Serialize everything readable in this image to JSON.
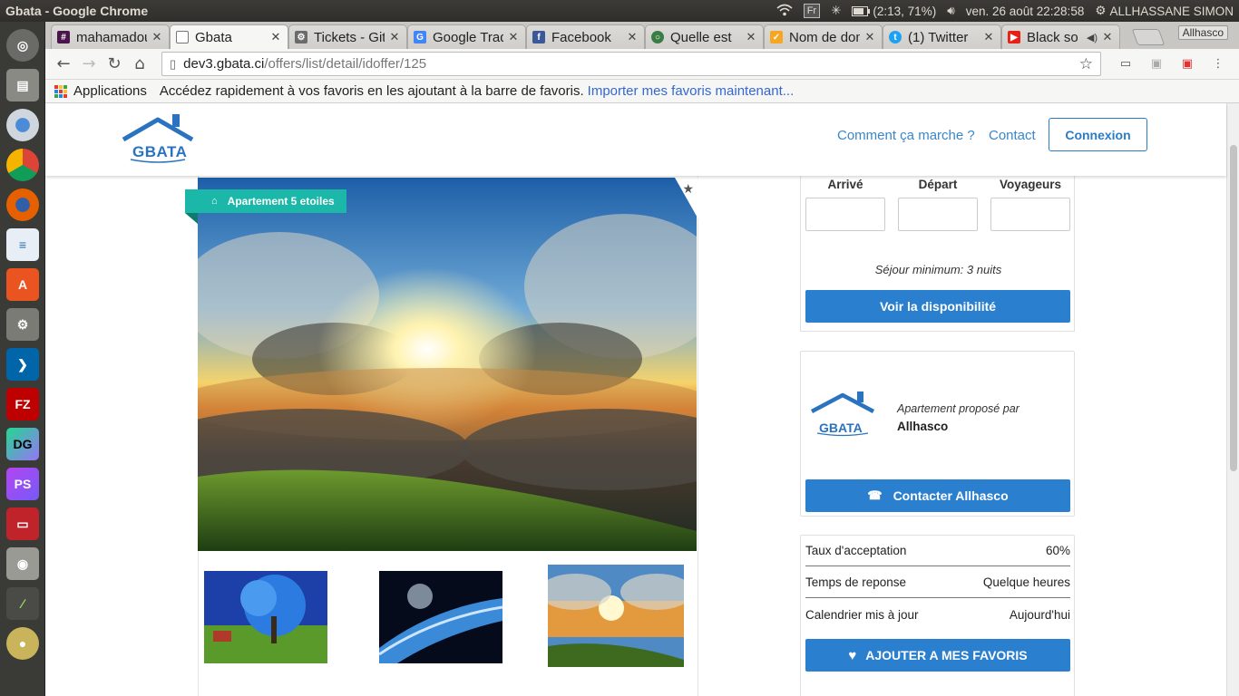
{
  "system": {
    "window_title": "Gbata - Google Chrome",
    "keyboard": "Fr",
    "battery": "(2:13, 71%)",
    "datetime": "ven. 26 août 22:28:58",
    "user": "ALLHASSANE SIMON"
  },
  "tabs": [
    {
      "label": "mahamadou",
      "icon": "slack-icon",
      "color": "#4a154b"
    },
    {
      "label": "Gbata",
      "icon": "page-icon",
      "color": "#ffffff",
      "active": true
    },
    {
      "label": "Tickets - GitLab",
      "icon": "gear-icon",
      "color": "#6b6b6b"
    },
    {
      "label": "Google Traduction",
      "icon": "google-translate-icon",
      "color": "#4285f4"
    },
    {
      "label": "Facebook",
      "icon": "facebook-icon",
      "color": "#3b5998"
    },
    {
      "label": "Quelle est",
      "icon": "globe-icon",
      "color": "#3a7d44"
    },
    {
      "label": "Nom de domaine",
      "icon": "check-icon",
      "color": "#f5a623"
    },
    {
      "label": "(1) Twitter",
      "icon": "twitter-icon",
      "color": "#1da1f2"
    },
    {
      "label": "Black so",
      "icon": "youtube-icon",
      "color": "#e62117"
    }
  ],
  "profile_label": "Allhasco",
  "address": {
    "host": "dev3.gbata.ci",
    "path": "/offers/list/detail/idoffer/125"
  },
  "bookmarks": {
    "apps_label": "Applications",
    "hint": "Accédez rapidement à vos favoris en les ajoutant à la barre de favoris.",
    "import_link": "Importer mes favoris maintenant..."
  },
  "site": {
    "logo_text": "GBATA",
    "nav": {
      "how_it_works": "Comment ça marche ?",
      "contact": "Contact",
      "login": "Connexion"
    },
    "accent": "#2a7fcf",
    "ribbon_color": "#1bb7a8"
  },
  "listing": {
    "badge": "Apartement 5 etoiles"
  },
  "booking": {
    "arrival_label": "Arrivé",
    "departure_label": "Départ",
    "travelers_label": "Voyageurs",
    "min_stay": "Séjour minimum: 3 nuits",
    "check_button": "Voir la disponibilité"
  },
  "host": {
    "proposed_by": "Apartement proposé par",
    "name": "Allhasco",
    "logo_text": "GBATA",
    "contact_button": "Contacter Allhasco"
  },
  "stats": [
    {
      "label": "Taux d'acceptation",
      "value": "60%"
    },
    {
      "label": "Temps de reponse",
      "value": "Quelque heures"
    },
    {
      "label": "Calendrier mis à jour",
      "value": "Aujourd'hui"
    }
  ],
  "favorites_button": "AJOUTER A MES FAVORIS"
}
